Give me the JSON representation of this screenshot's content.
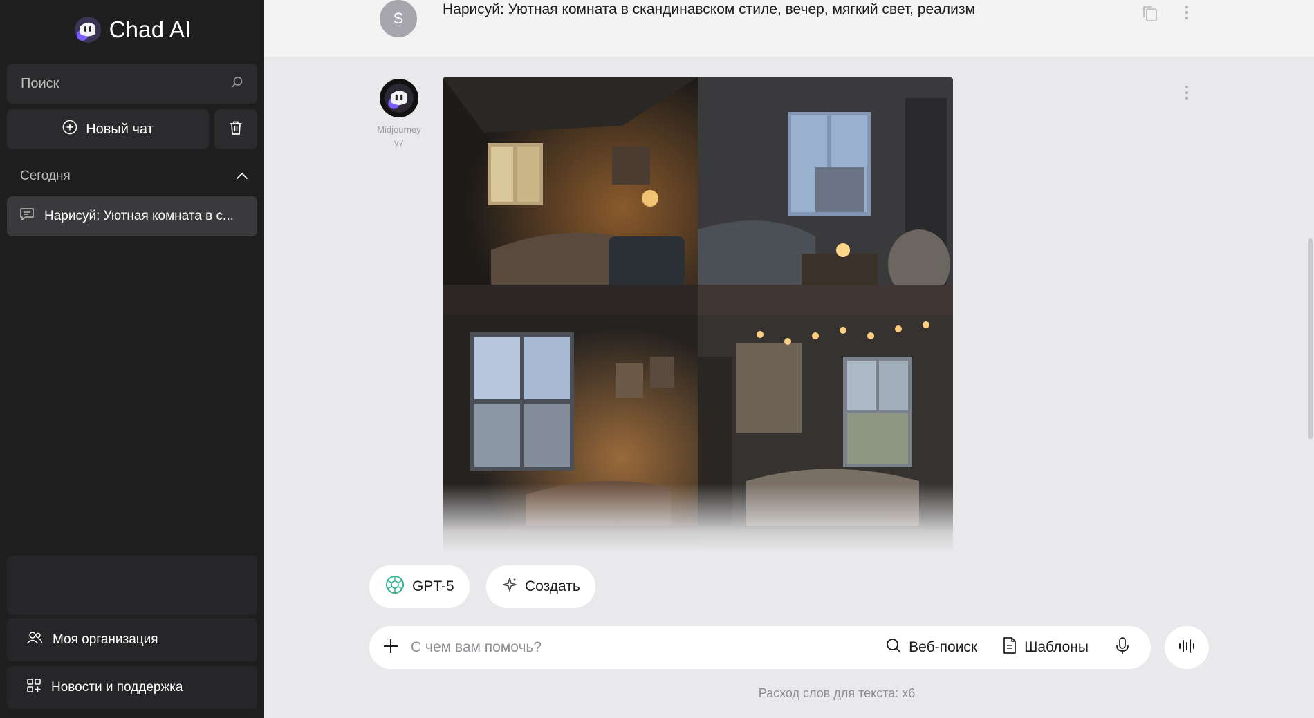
{
  "app": {
    "title": "Chad AI"
  },
  "sidebar": {
    "search_placeholder": "Поиск",
    "new_chat_label": "Новый чат",
    "section_title": "Сегодня",
    "chats": [
      {
        "label": "Нарисуй: Уютная комната в с..."
      }
    ],
    "org_label": "Моя организация",
    "news_label": "Новости и поддержка"
  },
  "conversation": {
    "user_initial": "S",
    "user_message": "Нарисуй: Уютная комната в скандинавском стиле, вечер, мягкий свет, реализм",
    "bot_name_line1": "Midjourney",
    "bot_name_line2": "v7"
  },
  "composer": {
    "model_chip": "GPT-5",
    "create_chip": "Создать",
    "placeholder": "С чем вам помочь?",
    "web_search_label": "Веб-поиск",
    "templates_label": "Шаблоны"
  },
  "footer": {
    "note": "Расход слов для текста: x6"
  },
  "colors": {
    "sidebar_bg": "#1e1e1f",
    "sidebar_item_active": "#3a3a3d",
    "main_bg": "#e9e9eb",
    "model_accent": "#35b58f"
  },
  "icons": {
    "logo": "chad-ai-logo-icon",
    "search": "search-icon",
    "new_chat": "plus-circle-icon",
    "delete": "trash-icon",
    "collapse_section": "chevron-up-icon",
    "chat": "chat-bubble-icon",
    "org": "users-icon",
    "news": "grid-plus-icon",
    "copy": "copy-icon",
    "more": "more-vertical-icon",
    "model": "openai-icon",
    "create": "sparkle-icon",
    "attach": "plus-icon",
    "web": "search-icon",
    "templates": "document-icon",
    "mic": "mic-icon",
    "voice": "waveform-icon"
  }
}
